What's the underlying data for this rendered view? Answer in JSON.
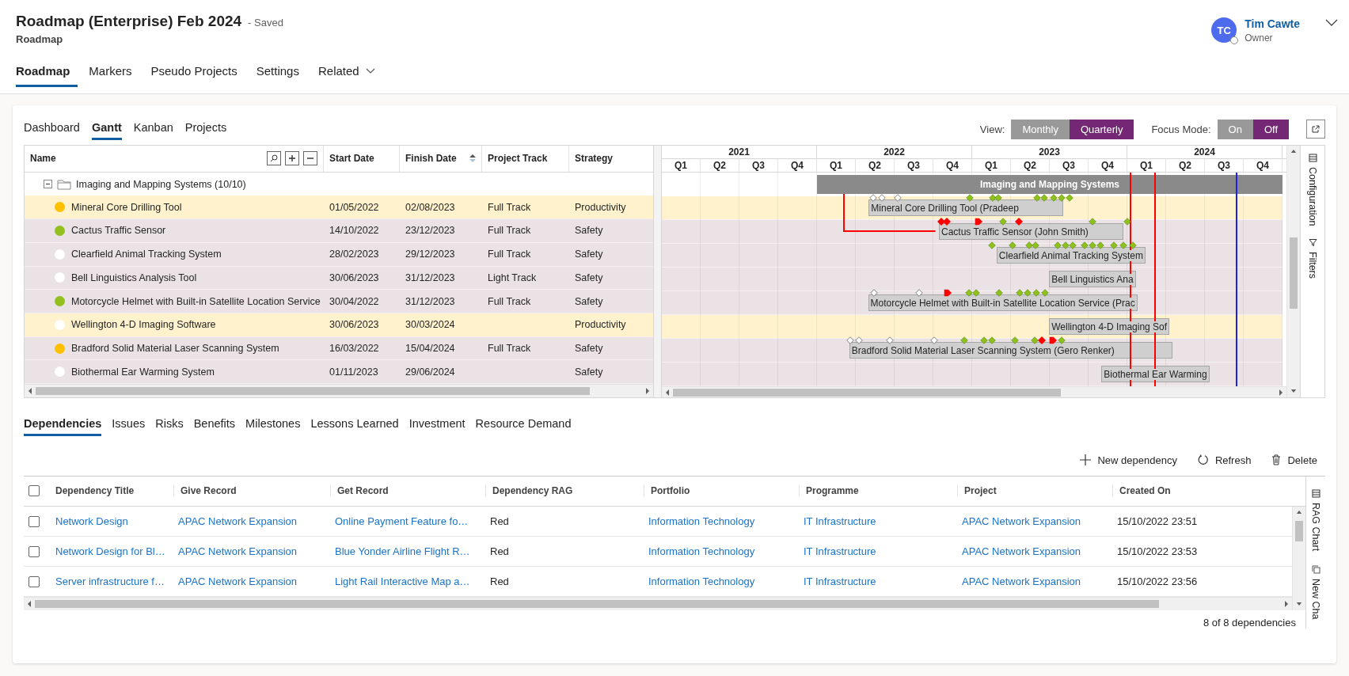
{
  "header": {
    "title": "Roadmap (Enterprise) Feb 2024",
    "save_status": "- Saved",
    "subtitle": "Roadmap"
  },
  "user": {
    "initials": "TC",
    "name": "Tim Cawte",
    "role": "Owner"
  },
  "main_tabs": [
    {
      "label": "Roadmap",
      "selected": true,
      "kind": "tab"
    },
    {
      "label": "Markers",
      "selected": false,
      "kind": "tab"
    },
    {
      "label": "Pseudo Projects",
      "selected": false,
      "kind": "tab"
    },
    {
      "label": "Settings",
      "selected": false,
      "kind": "tab"
    },
    {
      "label": "Related",
      "selected": false,
      "kind": "dropdown"
    }
  ],
  "view_tabs": [
    {
      "label": "Dashboard",
      "selected": false
    },
    {
      "label": "Gantt",
      "selected": true
    },
    {
      "label": "Kanban",
      "selected": false
    },
    {
      "label": "Projects",
      "selected": false
    }
  ],
  "view_toggle": {
    "label": "View:",
    "options": [
      {
        "label": "Monthly",
        "selected": false
      },
      {
        "label": "Quarterly",
        "selected": true
      }
    ]
  },
  "focus_toggle": {
    "label": "Focus Mode:",
    "options": [
      {
        "label": "On",
        "selected": false
      },
      {
        "label": "Off",
        "selected": true
      }
    ]
  },
  "gantt": {
    "columns": [
      {
        "label": "Name",
        "sorted": false
      },
      {
        "label": "Start Date",
        "sorted": false
      },
      {
        "label": "Finish Date",
        "sorted": true
      },
      {
        "label": "Project Track",
        "sorted": false
      },
      {
        "label": "Strategy",
        "sorted": false
      }
    ],
    "years": [
      {
        "label": "2021",
        "quarters": [
          "Q1",
          "Q2",
          "Q3",
          "Q4"
        ]
      },
      {
        "label": "2022",
        "quarters": [
          "Q1",
          "Q2",
          "Q3",
          "Q4"
        ]
      },
      {
        "label": "2023",
        "quarters": [
          "Q1",
          "Q2",
          "Q3",
          "Q4"
        ]
      },
      {
        "label": "2024",
        "quarters": [
          "Q1",
          "Q2",
          "Q3",
          "Q4"
        ]
      }
    ],
    "group": {
      "name": "Imaging and Mapping Systems (10/10)",
      "expanded": true,
      "bar_label": "Imaging and Mapping Systems"
    },
    "rows": [
      {
        "name": "Mineral Core Drilling Tool",
        "color": "#ffc000",
        "start": "01/05/2022",
        "finish": "02/08/2023",
        "track": "Full Track",
        "strategy": "Productivity",
        "highlighted": true,
        "bar_label": "Mineral Core Drilling Tool (Pradeep"
      },
      {
        "name": "Cactus Traffic Sensor",
        "color": "#92c01f",
        "start": "14/10/2022",
        "finish": "23/12/2023",
        "track": "Full Track",
        "strategy": "Safety",
        "highlighted": false,
        "bar_label": "Cactus Traffic Sensor (John Smith)"
      },
      {
        "name": "Clearfield Animal Tracking System",
        "color": "#ffffff",
        "start": "28/02/2023",
        "finish": "29/12/2023",
        "track": "Full Track",
        "strategy": "Safety",
        "highlighted": false,
        "bar_label": "Clearfield Animal Tracking System"
      },
      {
        "name": "Bell Linguistics Analysis Tool",
        "color": "#ffffff",
        "start": "30/06/2023",
        "finish": "31/12/2023",
        "track": "Light Track",
        "strategy": "Safety",
        "highlighted": false,
        "bar_label": "Bell Linguistics Ana"
      },
      {
        "name": "Motorcycle Helmet with Built-in Satellite Location Service",
        "color": "#92c01f",
        "start": "30/04/2022",
        "finish": "31/12/2023",
        "track": "Full Track",
        "strategy": "Safety",
        "highlighted": false,
        "bar_label": "Motorcycle Helmet with Built-in Satellite Location Service (Prac"
      },
      {
        "name": "Wellington 4-D Imaging Software",
        "color": "#ffffff",
        "start": "30/06/2023",
        "finish": "30/03/2024",
        "strategy": "Productivity",
        "highlighted": true,
        "bar_label": "Wellington 4-D Imaging Sof"
      },
      {
        "name": "Bradford Solid Material Laser Scanning System",
        "color": "#ffc000",
        "start": "16/03/2022",
        "finish": "15/04/2024",
        "track": "Full Track",
        "strategy": "Safety",
        "highlighted": false,
        "bar_label": "Bradford Solid Material Laser Scanning System (Gero Renker)"
      },
      {
        "name": "Biothermal Ear Warming System",
        "color": "#ffffff",
        "start": "01/11/2023",
        "finish": "29/06/2024",
        "strategy": "Safety",
        "highlighted": false,
        "bar_label": "Biothermal Ear Warming"
      }
    ],
    "side_panel": [
      {
        "label": "Configuration",
        "kind": "configuration"
      },
      {
        "label": "Filters",
        "kind": "filters"
      }
    ]
  },
  "detail_tabs": [
    {
      "label": "Dependencies",
      "selected": true
    },
    {
      "label": "Issues",
      "selected": false
    },
    {
      "label": "Risks",
      "selected": false
    },
    {
      "label": "Benefits",
      "selected": false
    },
    {
      "label": "Milestones",
      "selected": false
    },
    {
      "label": "Lessons Learned",
      "selected": false
    },
    {
      "label": "Investment",
      "selected": false
    },
    {
      "label": "Resource Demand",
      "selected": false
    }
  ],
  "toolbar": [
    {
      "label": "New dependency",
      "kind": "add"
    },
    {
      "label": "Refresh",
      "kind": "refresh"
    },
    {
      "label": "Delete",
      "kind": "delete"
    }
  ],
  "dependencies": {
    "all_selected": false,
    "columns": [
      {
        "label": "Dependency Title",
        "link": true
      },
      {
        "label": "Give Record",
        "link": true
      },
      {
        "label": "Get Record",
        "link": true
      },
      {
        "label": "Dependency RAG",
        "link": false
      },
      {
        "label": "Portfolio",
        "link": true
      },
      {
        "label": "Programme",
        "link": true
      },
      {
        "label": "Project",
        "link": true
      },
      {
        "label": "Created On",
        "link": false
      }
    ],
    "rows": [
      {
        "checked": false,
        "cells": [
          "Network Design",
          "APAC Network Expansion",
          "Online Payment Feature fo…",
          "Red",
          "Information Technology",
          "IT Infrastructure",
          "APAC Network Expansion",
          "15/10/2022 23:51"
        ]
      },
      {
        "checked": false,
        "cells": [
          "Network Design for Bl…",
          "APAC Network Expansion",
          "Blue Yonder Airline Flight R…",
          "Red",
          "Information Technology",
          "IT Infrastructure",
          "APAC Network Expansion",
          "15/10/2022 23:53"
        ]
      },
      {
        "checked": false,
        "cells": [
          "Server infrastructure f…",
          "APAC Network Expansion",
          "Light Rail Interactive Map a…",
          "Red",
          "Information Technology",
          "IT Infrastructure",
          "APAC Network Expansion",
          "15/10/2022 23:56"
        ]
      }
    ],
    "count": "8 of 8 dependencies",
    "side_panel": [
      {
        "label": "RAG Chart",
        "kind": "table"
      },
      {
        "label": "New Cha",
        "kind": "copy"
      }
    ]
  }
}
